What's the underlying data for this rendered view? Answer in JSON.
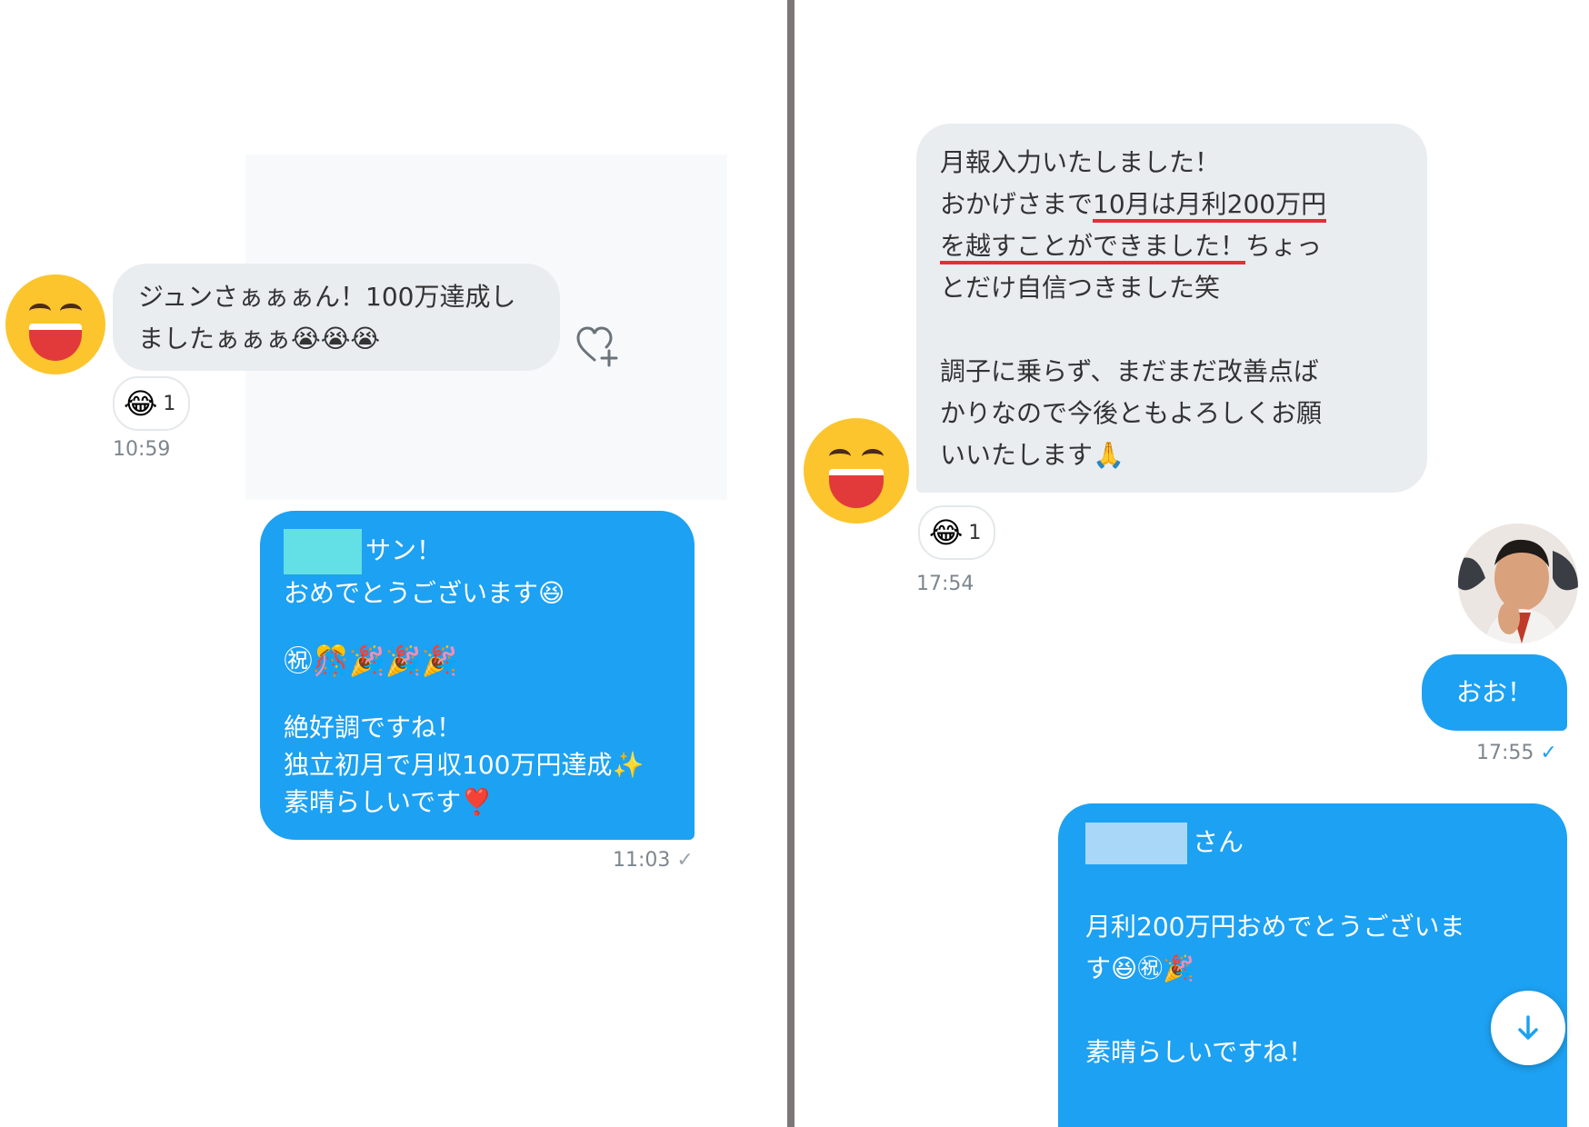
{
  "left": {
    "incoming": {
      "line1": "ジュンさぁぁぁん！100万達成し",
      "line2": "ましたぁぁぁ😭😭😭",
      "reaction_emoji": "😂",
      "reaction_count": "1",
      "time": "10:59"
    },
    "outgoing": {
      "greeting": "サン！",
      "line1": "おめでとうございます😆",
      "emoji_row": "㊗🎊🎉🎉🎉",
      "line3": "絶好調ですね！",
      "line4": "独立初月で月収100万円達成✨",
      "line5": "素晴らしいです❣️",
      "time": "11:03",
      "check": "✓"
    }
  },
  "right": {
    "incoming": {
      "l1": "月報入力いたしました！",
      "l2a": "おかげさまで",
      "l2b": "10月は月利200万円",
      "l3a": "を越すことができました！",
      "l3b": "ちょっ",
      "l4": "とだけ自信つきました笑",
      "l5": "調子に乗らず、まだまだ改善点ば",
      "l6": "かりなので今後ともよろしくお願",
      "l7": "いいたします🙏",
      "reaction_emoji": "😂",
      "reaction_count": "1",
      "time": "17:54"
    },
    "reply": {
      "text": "おお！",
      "time": "17:55",
      "check": "✓"
    },
    "outgoing": {
      "greeting": "さん",
      "line1": "月利200万円おめでとうございま",
      "line2": "す😆㊗🎉",
      "line3": "素晴らしいですね！"
    }
  },
  "colors": {
    "outgoing_bubble": "#1da1f2",
    "incoming_bubble": "#e9edf0",
    "underline": "#e03038",
    "divider": "#7d7678"
  }
}
